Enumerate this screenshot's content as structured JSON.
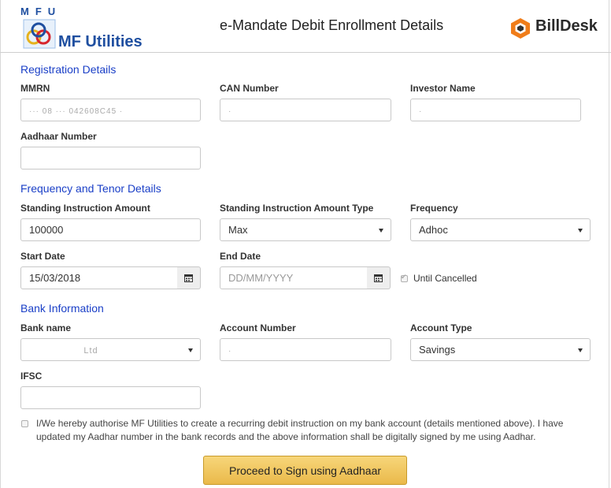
{
  "header": {
    "mfu_letters": "MFU",
    "mfu_name": "MF Utilities",
    "title": "e-Mandate Debit Enrollment Details",
    "billdesk_name": "BillDesk"
  },
  "registration": {
    "section_title": "Registration Details",
    "mmrn_label": "MMRN",
    "mmrn_value": "··· 08 ··· 042608C45 ·",
    "can_label": "CAN Number",
    "can_value": "·",
    "investor_label": "Investor Name",
    "investor_value": "·",
    "aadhaar_label": "Aadhaar Number",
    "aadhaar_value": ""
  },
  "frequency": {
    "section_title": "Frequency and Tenor Details",
    "amount_label": "Standing Instruction Amount",
    "amount_value": "100000",
    "amount_type_label": "Standing Instruction Amount Type",
    "amount_type_value": "Max",
    "frequency_label": "Frequency",
    "frequency_value": "Adhoc",
    "start_label": "Start Date",
    "start_value": "15/03/2018",
    "end_label": "End Date",
    "end_placeholder": "DD/MM/YYYY",
    "until_cancelled_label": "Until Cancelled"
  },
  "bank": {
    "section_title": "Bank Information",
    "bank_name_label": "Bank name",
    "bank_name_value": "Ltd",
    "account_number_label": "Account Number",
    "account_number_value": "·",
    "account_type_label": "Account Type",
    "account_type_value": "Savings",
    "ifsc_label": "IFSC",
    "ifsc_value": ""
  },
  "consent_text": "I/We hereby authorise MF Utilities to create a recurring debit instruction on my bank account (details mentioned above). I have updated my Aadhar number in the bank records and the above information shall be digitally signed by me using Aadhar.",
  "proceed_label": "Proceed to Sign using Aadhaar",
  "colors": {
    "section_title": "#1a3fc7",
    "brand_blue": "#1f4fa0",
    "button_gold": "#eab94a",
    "billdesk_orange": "#f07d1a"
  }
}
